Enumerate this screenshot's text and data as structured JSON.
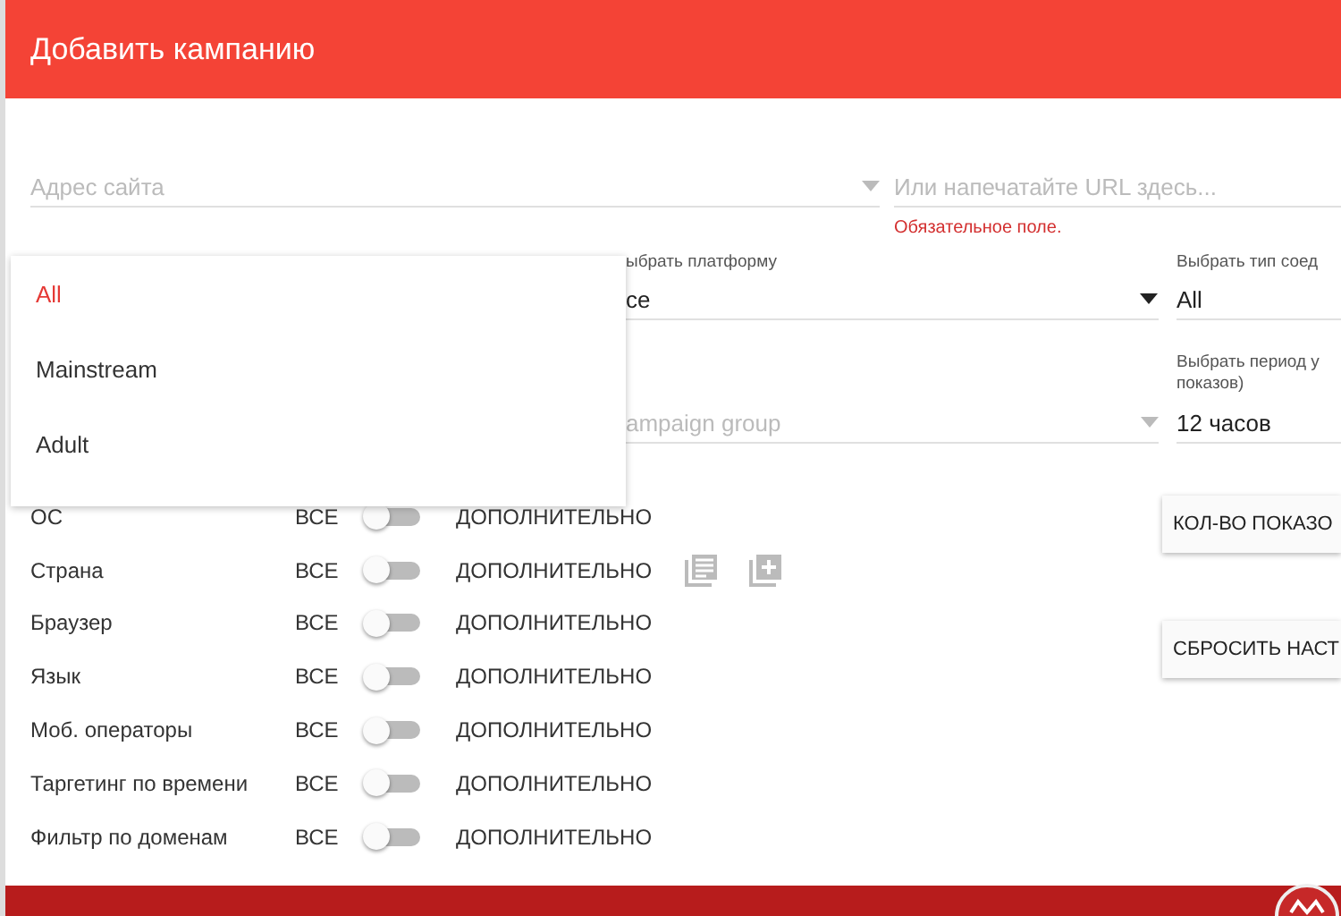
{
  "dialog": {
    "title": "Добавить кампанию"
  },
  "site_select": {
    "placeholder": "Адрес сайта"
  },
  "url_field": {
    "placeholder": "Или напечатайте URL здесь...",
    "error": "Обязательное поле."
  },
  "platform_select": {
    "label": "ыбрать платформу",
    "value": "се"
  },
  "connection_select": {
    "label": "Выбрать тип соед",
    "value": "All"
  },
  "group_select": {
    "placeholder": "ampaign group"
  },
  "period_select": {
    "label": "Выбрать период у\nпоказов)",
    "value": "12 часов"
  },
  "dropdown_menu": [
    {
      "label": "All",
      "selected": true
    },
    {
      "label": "Mainstream",
      "selected": false
    },
    {
      "label": "Adult",
      "selected": false
    }
  ],
  "targeting": [
    {
      "label": "ОС",
      "all": "ВСЕ",
      "checked": false,
      "extra": "ДОПОЛНИТЕЛЬНО",
      "icons": false
    },
    {
      "label": "Страна",
      "all": "ВСЕ",
      "checked": false,
      "extra": "ДОПОЛНИТЕЛЬНО",
      "icons": true
    },
    {
      "label": "Браузер",
      "all": "ВСЕ",
      "checked": false,
      "extra": "ДОПОЛНИТЕЛЬНО",
      "icons": false
    },
    {
      "label": "Язык",
      "all": "ВСЕ",
      "checked": false,
      "extra": "ДОПОЛНИТЕЛЬНО",
      "icons": false
    },
    {
      "label": "Моб. операторы",
      "all": "ВСЕ",
      "checked": false,
      "extra": "ДОПОЛНИТЕЛЬНО",
      "icons": false
    },
    {
      "label": "Таргетинг по времени",
      "all": "ВСЕ",
      "checked": false,
      "extra": "ДОПОЛНИТЕЛЬНО",
      "icons": false
    },
    {
      "label": "Фильтр по доменам",
      "all": "ВСЕ",
      "checked": false,
      "extra": "ДОПОЛНИТЕЛЬНО",
      "icons": false
    }
  ],
  "side_buttons": [
    "КОЛ-ВО ПОКАЗО",
    "СБРОСИТЬ НАСТ"
  ]
}
